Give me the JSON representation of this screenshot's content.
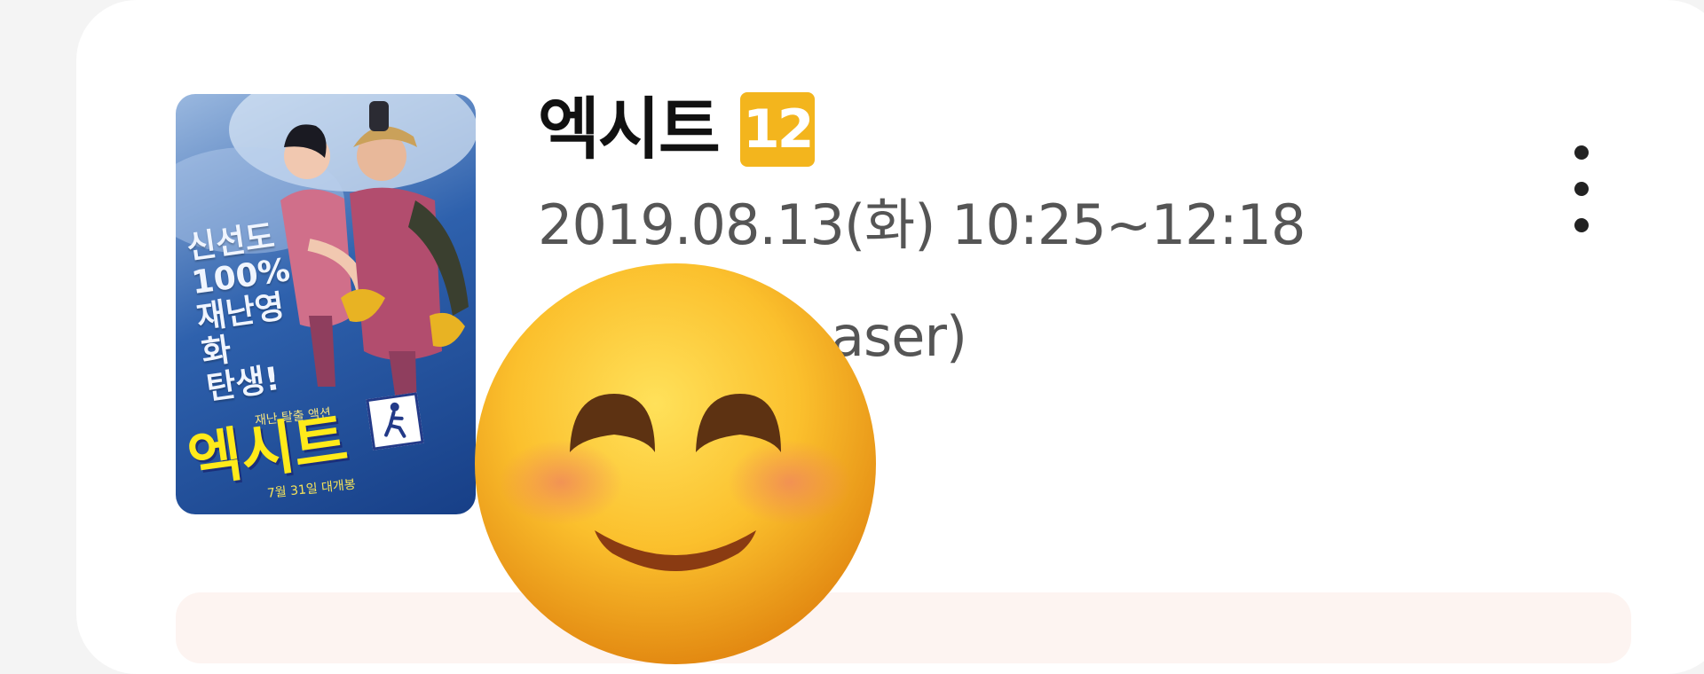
{
  "movie": {
    "title": "엑시트",
    "age_rating": "12",
    "showtime": "2019.08.13(화) 10:25~12:18",
    "theater": "aser)"
  },
  "poster": {
    "tagline": [
      "신선도",
      "100%",
      "재난영화",
      "탄생!"
    ],
    "subtitle": "재난 탈출 액션",
    "title": "엑시트",
    "release": "7월 31일 대개봉"
  },
  "menu": {
    "icon": "more-vertical-icon"
  },
  "overlay": {
    "icon": "smiling-face-emoji"
  },
  "colors": {
    "card_background": "#ffffff",
    "page_background": "#f4f4f4",
    "age_badge": "#f3b51d",
    "poster_title": "#ffea1a",
    "bottom_panel": "#fdf4f1"
  }
}
